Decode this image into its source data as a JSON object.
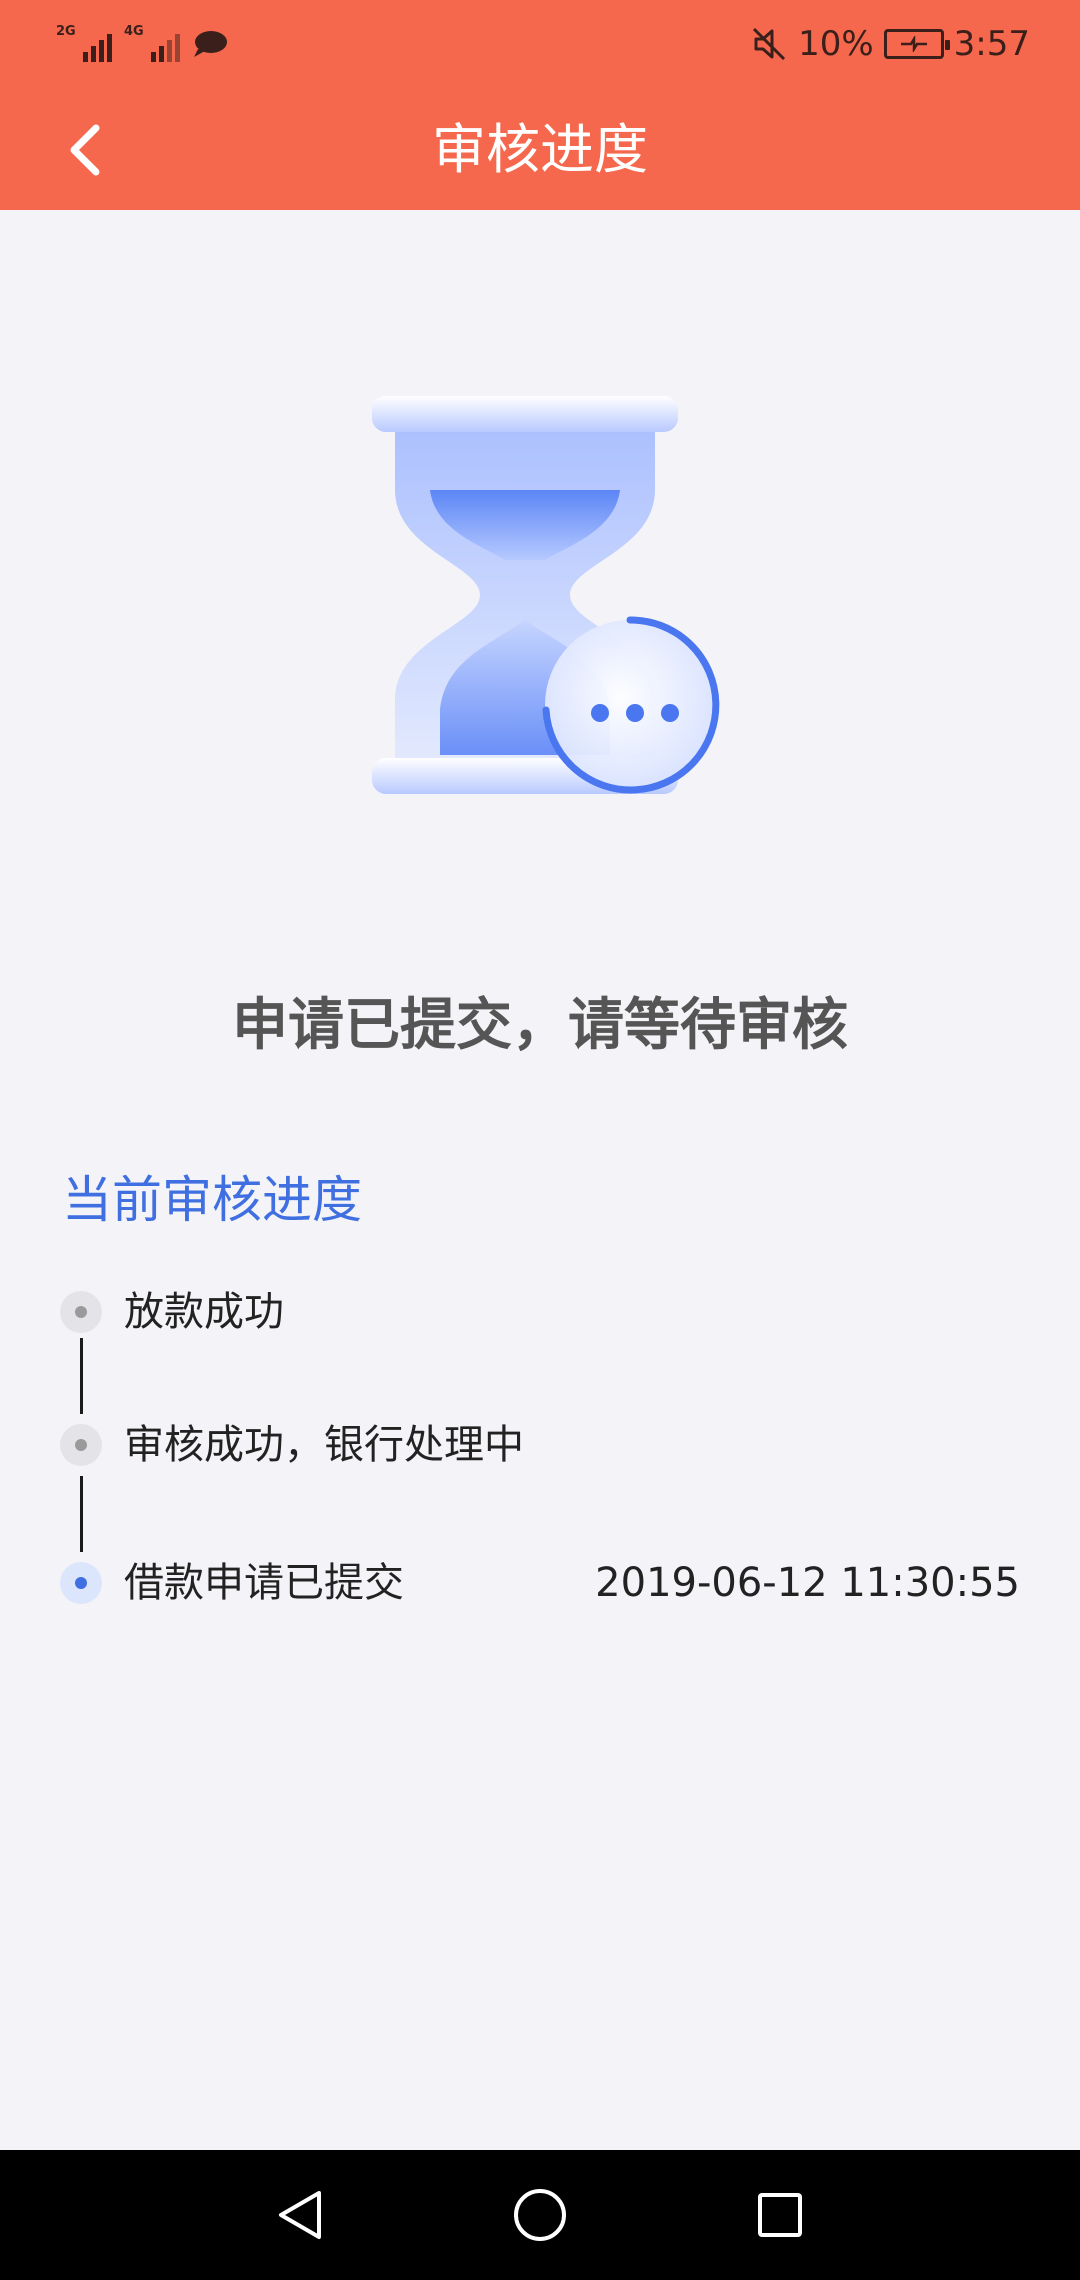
{
  "status_bar": {
    "net1": "2G",
    "net2": "4G",
    "battery": "10%",
    "time": "3:57"
  },
  "header": {
    "title": "审核进度"
  },
  "hero": {
    "icon": "hourglass-icon"
  },
  "main_message": "申请已提交，请等待审核",
  "progress": {
    "section_title": "当前审核进度",
    "steps": [
      {
        "label": "放款成功",
        "time": "",
        "active": false
      },
      {
        "label": "审核成功，银行处理中",
        "time": "",
        "active": false
      },
      {
        "label": "借款申请已提交",
        "time": "2019-06-12 11:30:55",
        "active": true
      }
    ]
  },
  "colors": {
    "header_bg": "#f5684d",
    "accent_blue": "#3f6fe0",
    "page_bg": "#f4f4f8"
  }
}
